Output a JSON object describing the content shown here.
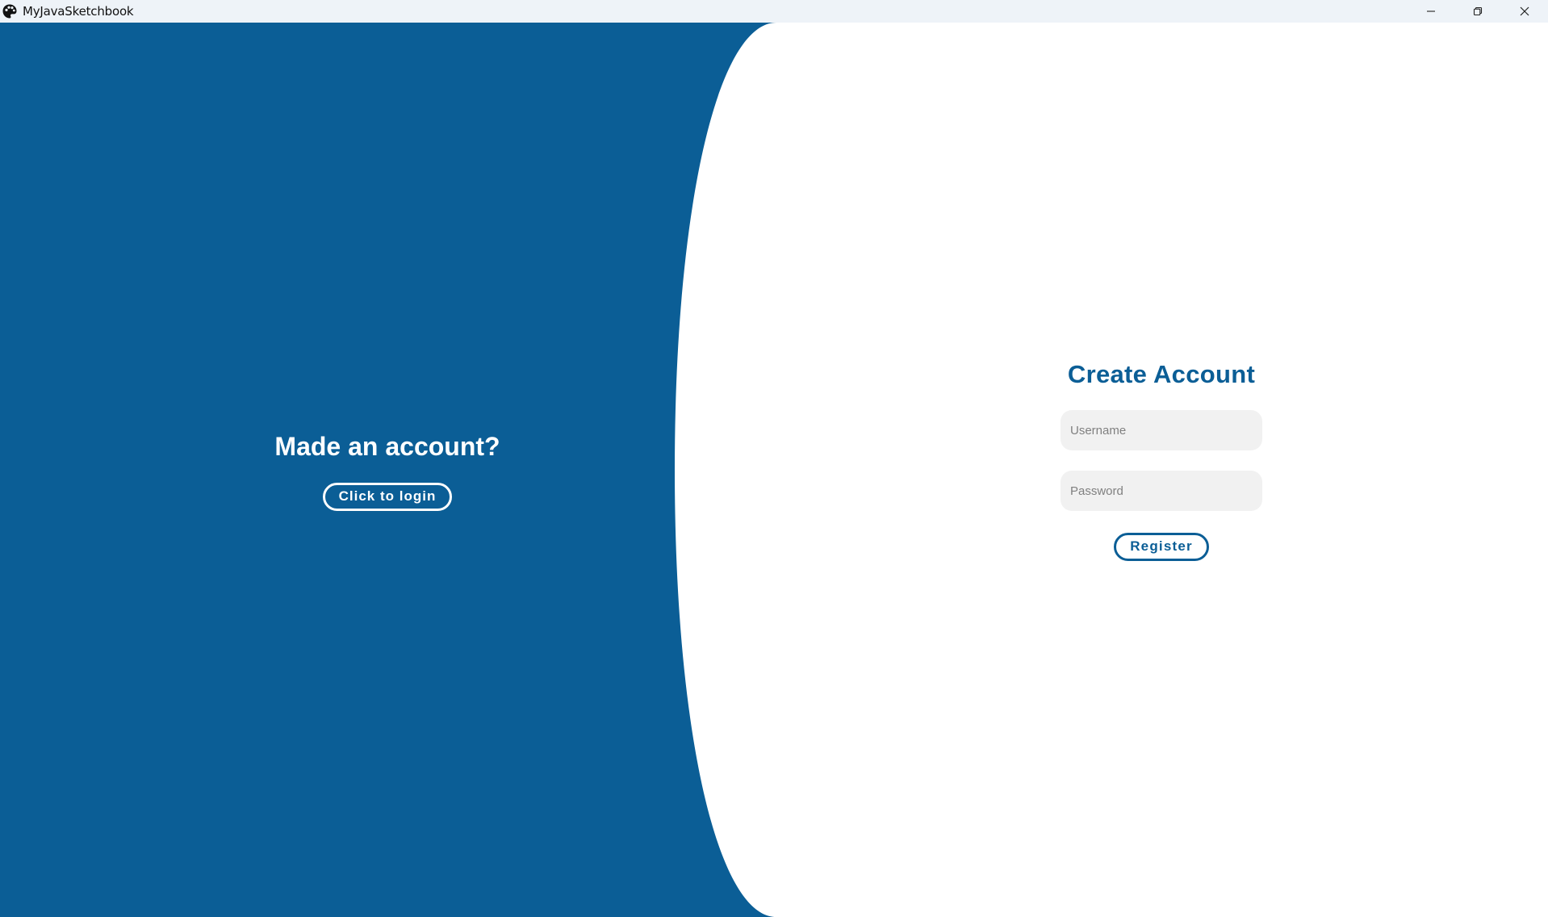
{
  "window": {
    "title": "MyJavaSketchbook",
    "app_icon": "palette-icon",
    "controls": {
      "minimize_icon": "minimize-icon",
      "maximize_icon": "restore-icon",
      "close_icon": "close-icon"
    }
  },
  "left_panel": {
    "heading": "Made an account?",
    "login_button_label": "Click to login"
  },
  "register_form": {
    "title": "Create Account",
    "username_placeholder": "Username",
    "username_value": "",
    "password_placeholder": "Password",
    "password_value": "",
    "register_button_label": "Register"
  },
  "colors": {
    "primary_blue": "#0b5e96",
    "background": "#ffffff",
    "titlebar": "#eef3f8",
    "input_background": "#f1f1f1"
  }
}
